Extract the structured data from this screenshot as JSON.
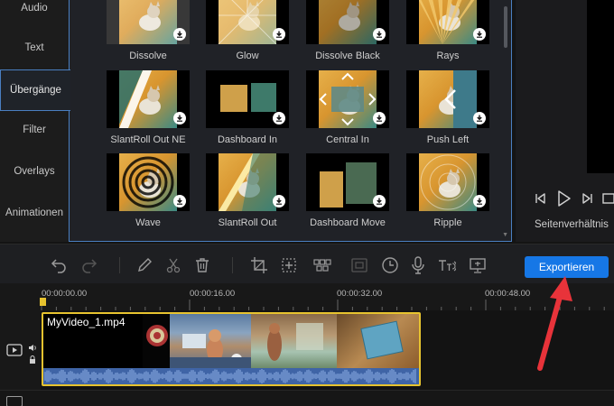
{
  "sidebar": {
    "items": [
      {
        "label": "Audio",
        "active": false
      },
      {
        "label": "Text",
        "active": false
      },
      {
        "label": "Übergänge",
        "active": true
      },
      {
        "label": "Filter",
        "active": false
      },
      {
        "label": "Overlays",
        "active": false
      },
      {
        "label": "Animationen",
        "active": false
      }
    ]
  },
  "transitions": [
    {
      "label": "Dissolve",
      "effect": "dissolve"
    },
    {
      "label": "Glow",
      "effect": "glow"
    },
    {
      "label": "Dissolve Black",
      "effect": "dissolve-black"
    },
    {
      "label": "Rays",
      "effect": "rays"
    },
    {
      "label": "SlantRoll Out NE",
      "effect": "slantroll"
    },
    {
      "label": "Dashboard In",
      "effect": "dashboard"
    },
    {
      "label": "Central In",
      "effect": "central"
    },
    {
      "label": "Push Left",
      "effect": "push-left"
    },
    {
      "label": "Wave",
      "effect": "wave"
    },
    {
      "label": "SlantRoll Out",
      "effect": "slantroll-out"
    },
    {
      "label": "Dashboard Move",
      "effect": "dashboard-move"
    },
    {
      "label": "Ripple",
      "effect": "ripple"
    }
  ],
  "preview": {
    "aspect_label": "Seitenverhältnis",
    "controls": [
      "previous-frame-icon",
      "play-icon",
      "next-frame-icon",
      "fullscreen-icon"
    ]
  },
  "toolbar": {
    "icons": [
      "undo-icon",
      "redo-icon",
      "edit-icon",
      "cut-icon",
      "delete-icon",
      "crop-icon",
      "zoom-icon",
      "mosaic-icon",
      "freeze-frame-icon",
      "speed-icon",
      "record-icon",
      "text-to-speech-icon",
      "screen-icon"
    ],
    "export_label": "Exportieren"
  },
  "ruler": {
    "ticks": [
      "00:00:00.00",
      "00:00:16.00",
      "00:00:32.00",
      "00:00:48.00"
    ]
  },
  "timeline": {
    "clip_name": "MyVideo_1.mp4"
  },
  "colors": {
    "accent": "#1677e6",
    "selection_border": "#4a7fc1",
    "playhead": "#e7c32f",
    "annotation_arrow": "#e8333a",
    "audio_wave": "#3f64a6"
  }
}
